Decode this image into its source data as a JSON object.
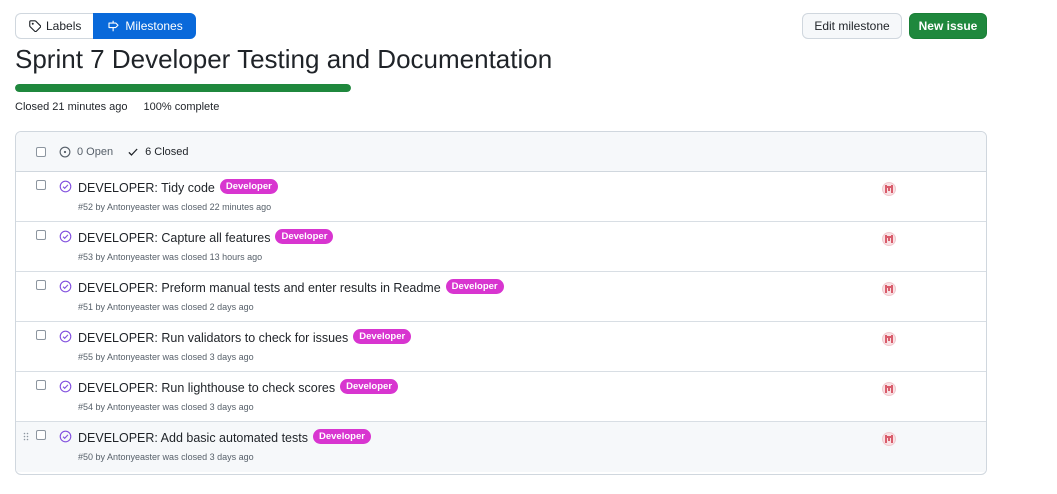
{
  "tabs": {
    "labels": "Labels",
    "milestones": "Milestones"
  },
  "actions": {
    "edit_milestone": "Edit milestone",
    "new_issue": "New issue"
  },
  "milestone": {
    "title": "Sprint 7 Developer Testing and Documentation",
    "closed_text": "Closed 21 minutes ago",
    "complete_text": "100% complete",
    "progress_fraction": 1.0
  },
  "list_header": {
    "open": "0 Open",
    "closed": "6 Closed"
  },
  "issues": [
    {
      "title": "DEVELOPER: Tidy code",
      "label": "Developer",
      "meta": "#52 by Antonyeaster was closed 22 minutes ago"
    },
    {
      "title": "DEVELOPER: Capture all features",
      "label": "Developer",
      "meta": "#53 by Antonyeaster was closed 13 hours ago"
    },
    {
      "title": "DEVELOPER: Preform manual tests and enter results in Readme",
      "label": "Developer",
      "meta": "#51 by Antonyeaster was closed 2 days ago"
    },
    {
      "title": "DEVELOPER: Run validators to check for issues",
      "label": "Developer",
      "meta": "#55 by Antonyeaster was closed 3 days ago"
    },
    {
      "title": "DEVELOPER: Run lighthouse to check scores",
      "label": "Developer",
      "meta": "#54 by Antonyeaster was closed 3 days ago"
    },
    {
      "title": "DEVELOPER: Add basic automated tests",
      "label": "Developer",
      "meta": "#50 by Antonyeaster was closed 3 days ago"
    }
  ],
  "colors": {
    "accent_blue": "#0969da",
    "success_green": "#1f883d",
    "label_magenta": "#d835d0",
    "closed_purple": "#8250df"
  }
}
